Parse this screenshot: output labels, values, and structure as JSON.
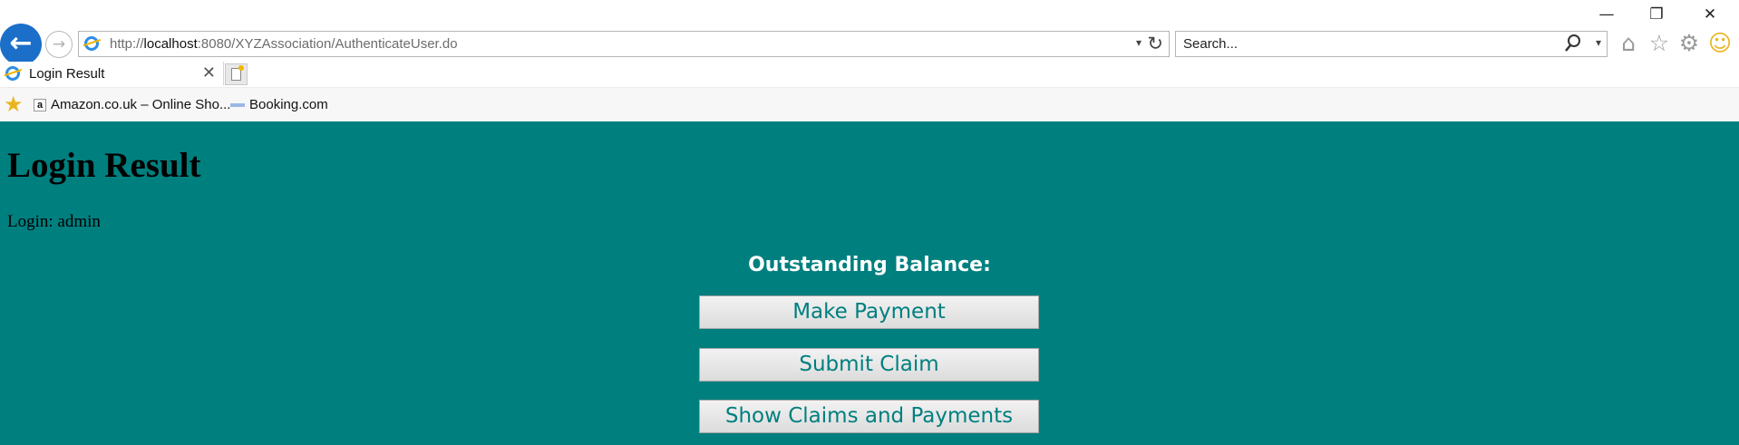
{
  "window": {
    "minimize_glyph": "—",
    "restore_glyph": "❐",
    "close_glyph": "✕"
  },
  "navigation": {
    "back_glyph": "←",
    "forward_glyph": "→"
  },
  "address_bar": {
    "url_prefix": "http://",
    "url_host": "localhost",
    "url_path": ":8080/XYZAssociation/AuthenticateUser.do",
    "dropdown_glyph": "▾",
    "refresh_glyph": "↻"
  },
  "search_bar": {
    "placeholder": "Search...",
    "dropdown_glyph": "▾"
  },
  "toolbar": {
    "home_glyph": "⌂",
    "favorites_glyph": "☆",
    "settings_glyph": "⚙",
    "feedback_glyph": "☺"
  },
  "tab": {
    "label": "Login Result",
    "close_glyph": "✕"
  },
  "favorites_bar": {
    "star_glyph": "★",
    "amazon_icon_letter": "a",
    "items": [
      {
        "label": "Amazon.co.uk – Online Sho..."
      },
      {
        "label": "Booking.com"
      }
    ]
  },
  "page": {
    "heading": "Login Result",
    "login_text": "Login: admin",
    "balance_label": "Outstanding Balance:",
    "buttons": [
      {
        "label": "Make Payment"
      },
      {
        "label": "Submit Claim"
      },
      {
        "label": "Show Claims and Payments"
      }
    ]
  },
  "colors": {
    "page_background": "#007f7f",
    "button_text": "#007f7f",
    "back_button": "#1b6fc9",
    "balance_text": "#ffffff"
  }
}
